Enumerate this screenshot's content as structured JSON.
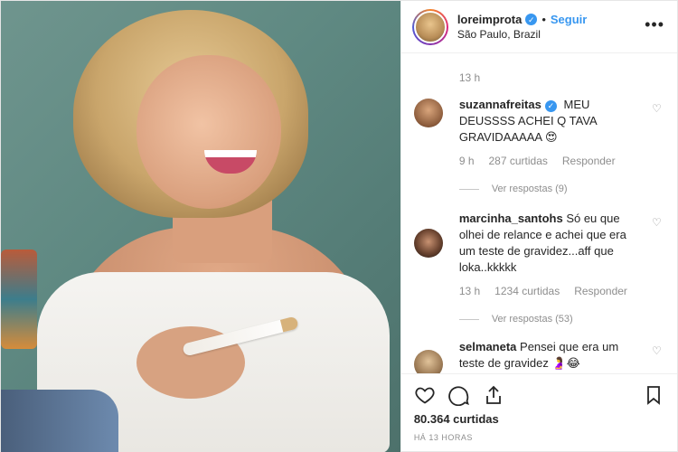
{
  "header": {
    "username": "loreimprota",
    "follow_label": "Seguir",
    "separator": "•",
    "location": "São Paulo, Brazil",
    "more_icon": "more-horizontal-icon",
    "verified_icon": "verified-badge-icon"
  },
  "post": {
    "caption_time": "13 h"
  },
  "comments": [
    {
      "username": "suzannafreitas",
      "verified": true,
      "text": "MEU DEUSSSS ACHEI Q TAVA GRAVIDAAAAA 😍",
      "time": "9 h",
      "likes": "287 curtidas",
      "reply_label": "Responder",
      "replies": "Ver respostas (9)"
    },
    {
      "username": "marcinha_santohs",
      "verified": false,
      "text": "Só eu que olhei de relance e achei que era um teste de gravidez...aff que loka..kkkkk",
      "time": "13 h",
      "likes": "1234 curtidas",
      "reply_label": "Responder",
      "replies": "Ver respostas (53)"
    },
    {
      "username": "selmaneta",
      "verified": false,
      "text": "Pensei que era um teste de gravidez 🤰😂"
    }
  ],
  "footer": {
    "likes": "80.364 curtidas",
    "time": "HÁ 13 HORAS"
  },
  "colors": {
    "accent": "#3897f0",
    "text": "#262626",
    "muted": "#8e8e8e"
  }
}
